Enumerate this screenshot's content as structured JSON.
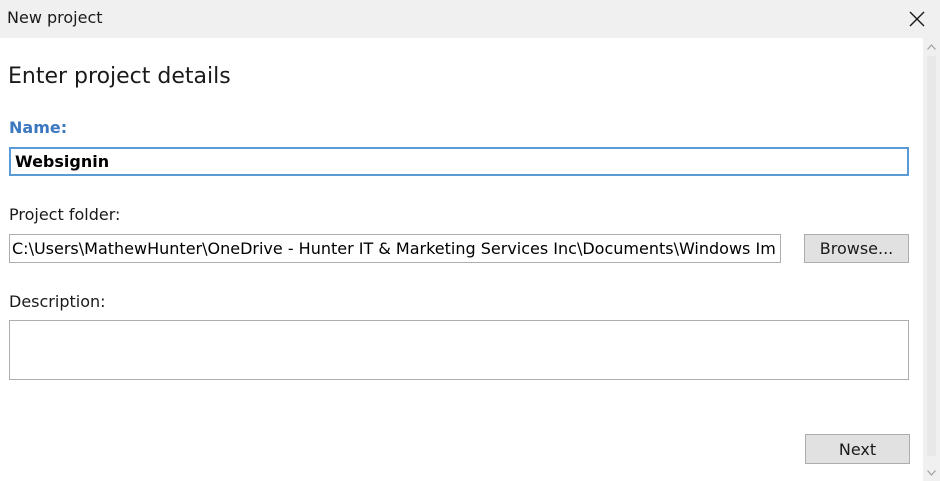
{
  "window": {
    "title": "New project"
  },
  "form": {
    "heading": "Enter project details",
    "name_label": "Name:",
    "name_value": "Websignin",
    "folder_label": "Project folder:",
    "folder_value": "C:\\Users\\MathewHunter\\OneDrive - Hunter IT & Marketing Services Inc\\Documents\\Windows Im",
    "browse_label": "Browse...",
    "description_label": "Description:",
    "description_value": "",
    "next_label": "Next"
  },
  "icons": {
    "close": "close-icon",
    "scroll_up": "chevron-up-icon",
    "scroll_down": "chevron-down-icon"
  },
  "colors": {
    "accent": "#5b9bd5",
    "label_accent": "#3c78c0",
    "titlebar": "#f0f0f0",
    "button": "#e1e1e1"
  }
}
